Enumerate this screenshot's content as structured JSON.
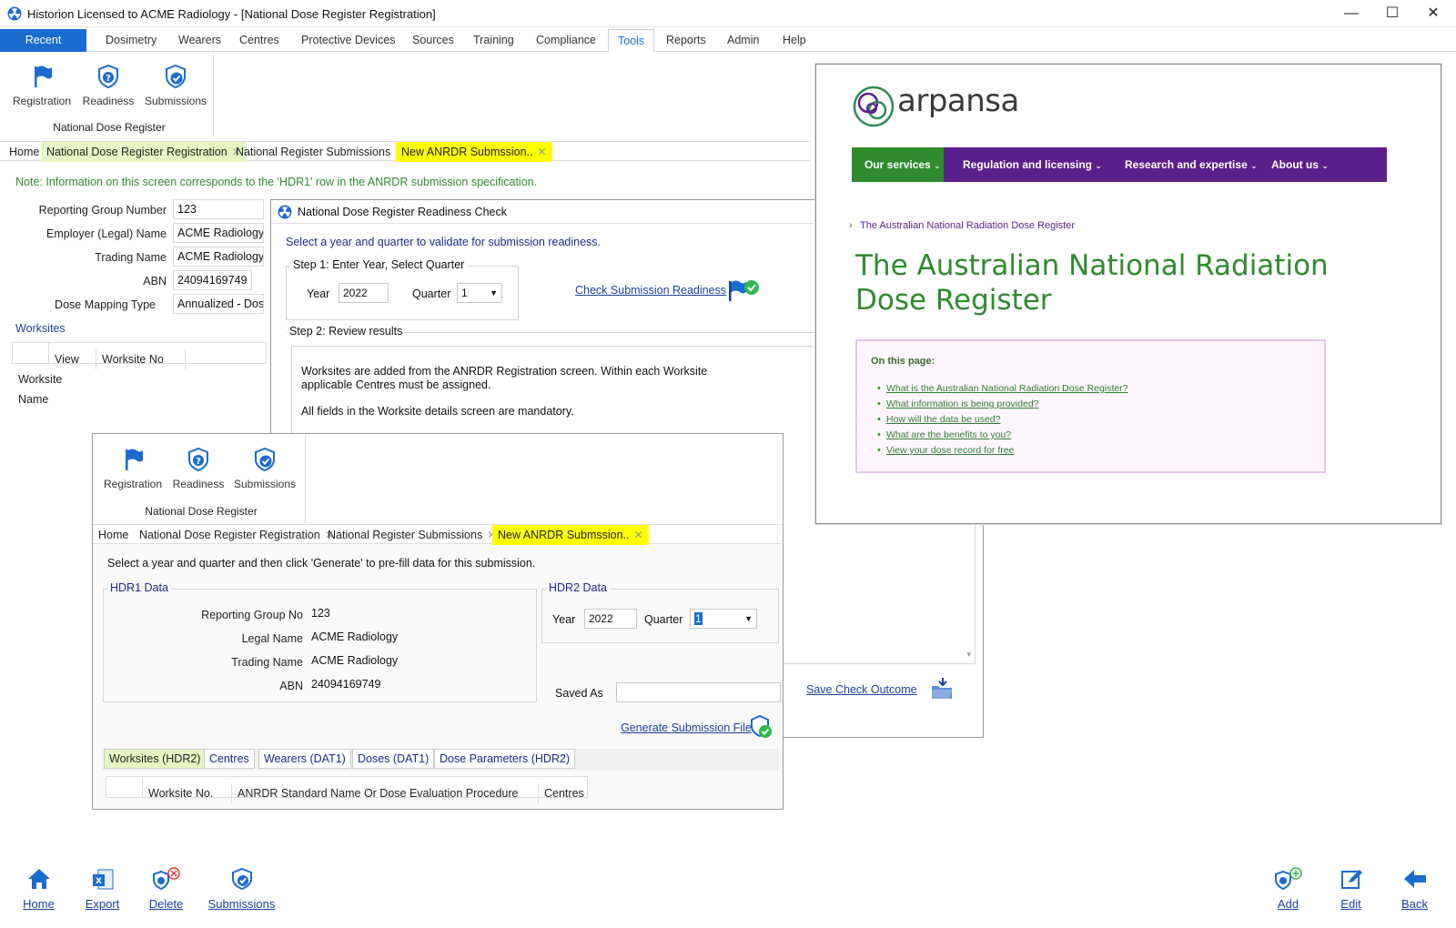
{
  "window": {
    "title": "Historion Licensed to ACME Radiology - [National Dose Register Registration]",
    "minimize": "—",
    "maximize": "☐",
    "close": "✕"
  },
  "menu": {
    "items": [
      "Recent",
      "Dosimetry",
      "Wearers",
      "Centres",
      "Protective Devices",
      "Sources",
      "Training",
      "Compliance",
      "Tools",
      "Reports",
      "Admin",
      "Help"
    ],
    "active": "Tools"
  },
  "ribbon": {
    "buttons": [
      "Registration",
      "Readiness",
      "Submissions"
    ],
    "group_label": "National Dose Register"
  },
  "doc_tabs": [
    "Home",
    "National Dose Register Registration",
    "National Register Submissions",
    "New ANRDR Submssion.."
  ],
  "registration": {
    "note": "Note: Information on this screen corresponds to the 'HDR1' row in the ANRDR submission specification.",
    "fields": [
      {
        "label": "Reporting Group Number",
        "value": "123"
      },
      {
        "label": "Employer (Legal) Name",
        "value": "ACME Radiology"
      },
      {
        "label": "Trading Name",
        "value": "ACME Radiology"
      },
      {
        "label": "ABN",
        "value": "24094169749"
      },
      {
        "label": "Dose Mapping Type",
        "value": "Annualized - Dose"
      }
    ],
    "worksites_label": "Worksites",
    "worksites_columns": [
      "",
      "View",
      "Worksite No",
      "Worksite Name"
    ]
  },
  "readiness": {
    "title": "National Dose Register Readiness Check",
    "instruction": "Select a year and quarter to validate for submission readiness.",
    "step1": "Step 1: Enter Year, Select Quarter",
    "year_label": "Year",
    "year_value": "2022",
    "quarter_label": "Quarter",
    "quarter_value": "1",
    "check_link": "Check Submission Readiness",
    "step2": "Step 2: Review results",
    "results_p1": "Worksites are added from the ANRDR Registration screen. Within each Worksite applicable Centres must be assigned.",
    "results_p2": "All fields in the Worksite details screen are mandatory.",
    "save_link": "Save Check Outcome"
  },
  "submission": {
    "instruction": "Select a year and quarter and then click 'Generate' to pre-fill data for this submission.",
    "hdr1_legend": "HDR1 Data",
    "hdr1_fields": [
      {
        "label": "Reporting Group No",
        "value": "123"
      },
      {
        "label": "Legal Name",
        "value": "ACME Radiology"
      },
      {
        "label": "Trading Name",
        "value": "ACME Radiology"
      },
      {
        "label": "ABN",
        "value": "24094169749"
      }
    ],
    "hdr2_legend": "HDR2 Data",
    "year_label": "Year",
    "year_value": "2022",
    "quarter_label": "Quarter",
    "quarter_value": "1",
    "saved_as_label": "Saved As",
    "saved_as_value": "",
    "generate_link": "Generate Submission File",
    "subtabs": [
      "Worksites (HDR2)",
      "Centres",
      "Wearers (DAT1)",
      "Doses (DAT1)",
      "Dose Parameters (HDR2)"
    ],
    "grid_columns": [
      "",
      "Worksite No.",
      "ANRDR Standard Name Or Dose Evaluation Procedure",
      "Centres"
    ]
  },
  "arpansa": {
    "logo_text": "arpansa",
    "nav": [
      "Our services",
      "Regulation and licensing",
      "Research and expertise",
      "About us"
    ],
    "breadcrumb": "The Australian National Radiation Dose Register",
    "heading_line1": "The Australian National Radiation",
    "heading_line2": "Dose Register",
    "on_this_page": "On this page:",
    "links": [
      "What is the Australian National Radiation Dose Register?",
      "What information is being provided?",
      "How will the data be used?",
      "What are the benefits to you?",
      "View your dose record for free"
    ],
    "colors": {
      "green": "#2f7d2f",
      "purple": "#5b1f8b",
      "pink_box": "#fbf3fb"
    }
  },
  "bottom_bar": {
    "left": [
      "Home",
      "Export",
      "Delete",
      "Submissions"
    ],
    "right": [
      "Add",
      "Edit",
      "Back"
    ]
  },
  "icons": [
    "radiation-app-icon",
    "flag-icon",
    "shield-question-icon",
    "shield-check-icon",
    "home-icon",
    "excel-export-icon",
    "delete-icon",
    "add-icon",
    "edit-icon",
    "back-arrow-icon",
    "folder-icon",
    "flag-check-icon"
  ]
}
